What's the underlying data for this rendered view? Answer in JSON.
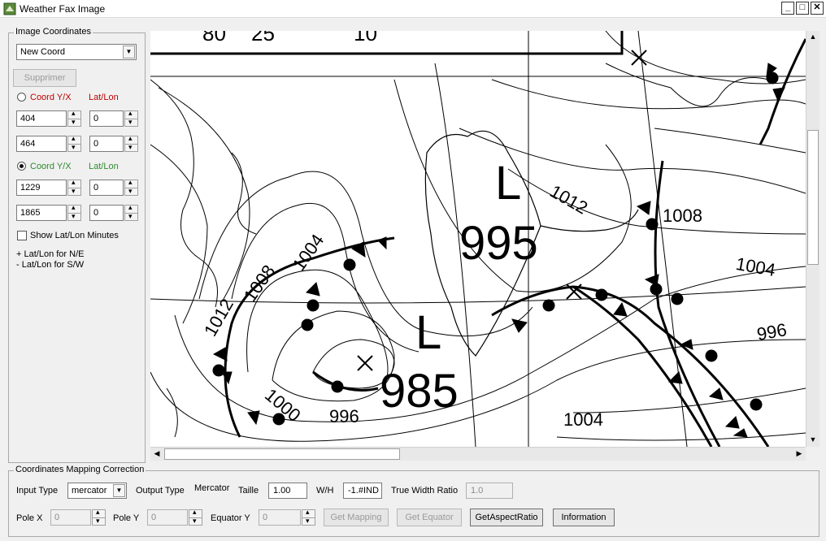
{
  "window": {
    "title": "Weather Fax Image",
    "minimize": "_",
    "maximize": "□",
    "close": "✕"
  },
  "image_coordinates": {
    "group_title": "Image Coordinates",
    "coord_select": "New Coord",
    "delete_button": "Supprimer",
    "set1": {
      "coord_label": "Coord Y/X",
      "latlon_label": "Lat/Lon",
      "selected": false,
      "rows": [
        {
          "coord": "404",
          "latlon": "0"
        },
        {
          "coord": "464",
          "latlon": "0"
        }
      ]
    },
    "set2": {
      "coord_label": "Coord Y/X",
      "latlon_label": "Lat/Lon",
      "selected": true,
      "rows": [
        {
          "coord": "1229",
          "latlon": "0"
        },
        {
          "coord": "1865",
          "latlon": "0"
        }
      ]
    },
    "show_minutes_label": "Show Lat/Lon Minutes",
    "show_minutes_checked": false,
    "hint_north_east": "+ Lat/Lon for N/E",
    "hint_south_west": "- Lat/Lon for S/W"
  },
  "map": {
    "top_labels": [
      "80",
      "25",
      "10"
    ],
    "isobar_labels": [
      "1012",
      "1008",
      "1004",
      "1004",
      "1008",
      "1012",
      "1000",
      "996",
      "1004",
      "996"
    ],
    "pressure_centers": [
      {
        "letter": "L",
        "value": "995"
      },
      {
        "letter": "L",
        "value": "985"
      }
    ]
  },
  "mapping_correction": {
    "group_title": "Coordinates Mapping Correction",
    "input_type_label": "Input Type",
    "input_type_value": "mercator",
    "output_type_label": "Output Type",
    "output_type_value": "Mercator",
    "taille_label": "Taille",
    "taille_value": "1.00",
    "wh_label": "W/H",
    "wh_value": "-1.#IND",
    "true_width_label": "True Width Ratio",
    "true_width_value": "1.0",
    "pole_x_label": "Pole X",
    "pole_x_value": "0",
    "pole_y_label": "Pole Y",
    "pole_y_value": "0",
    "equator_y_label": "Equator Y",
    "equator_y_value": "0",
    "get_mapping_button": "Get Mapping",
    "get_equator_button": "Get Equator",
    "get_aspect_button": "GetAspectRatio",
    "information_button": "Information"
  },
  "colors": {
    "window_bg": "#f0f0f0",
    "coord_red": "#c00000",
    "coord_green": "#2e8b2e"
  }
}
